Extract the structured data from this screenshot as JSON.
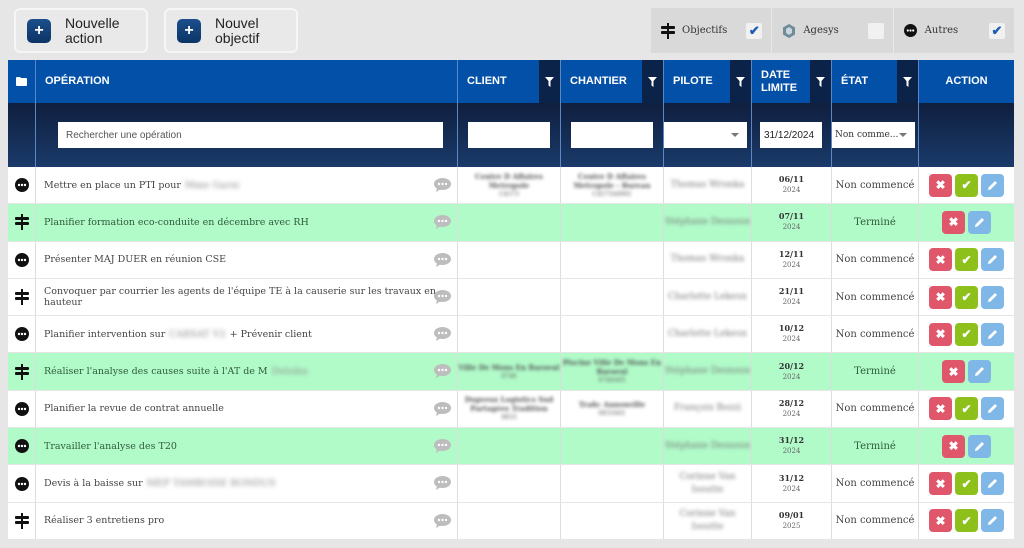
{
  "toolbar": {
    "new_action": "Nouvelle\naction",
    "new_objective": "Nouvel\nobjectif"
  },
  "type_filters": [
    {
      "label": "Objectifs",
      "icon": "signpost-icon",
      "checked": true
    },
    {
      "label": "Agesys",
      "icon": "agesys-logo-icon",
      "checked": false
    },
    {
      "label": "Autres",
      "icon": "ellipsis-circle-icon",
      "checked": true
    }
  ],
  "table": {
    "headers": {
      "operation": "OPÉRATION",
      "client": "CLIENT",
      "chantier": "CHANTIER",
      "pilote": "PILOTE",
      "date_limite": "DATE LIMITE",
      "etat": "ÉTAT",
      "action": "ACTION"
    },
    "filters": {
      "search_placeholder": "Rechercher une opération",
      "client_value": "",
      "chantier_value": "",
      "pilote_value": "",
      "date_value": "31/12/2024",
      "etat_value": "Non comme..."
    },
    "rows": [
      {
        "type": "autre",
        "operation": "Mettre en place un PTI pour",
        "operation_blur": "Mme Garni",
        "client": "Centre D Affaires Metropole",
        "client_code": "C4573",
        "chantier": "Centre D Affaires Metropole - Bureau",
        "chantier_code": "C4573A0001",
        "pilote": "Thomas Wronka",
        "date": "06/11",
        "year": "2024",
        "etat": "Non commencé",
        "done": false
      },
      {
        "type": "objectif",
        "operation": "Planifier formation eco-conduite en décembre avec RH",
        "operation_blur": "",
        "client": "",
        "client_code": "",
        "chantier": "",
        "chantier_code": "",
        "pilote": "Stéphane Desnoux",
        "date": "07/11",
        "year": "2024",
        "etat": "Terminé",
        "done": true
      },
      {
        "type": "autre",
        "operation": "Présenter MAJ DUER en réunion CSE",
        "operation_blur": "",
        "client": "",
        "client_code": "",
        "chantier": "",
        "chantier_code": "",
        "pilote": "Thomas Wronka",
        "date": "12/11",
        "year": "2024",
        "etat": "Non commencé",
        "done": false
      },
      {
        "type": "objectif",
        "operation": "Convoquer par courrier les agents de l'équipe TE à la causerie sur les travaux en hauteur",
        "operation_blur": "",
        "client": "",
        "client_code": "",
        "chantier": "",
        "chantier_code": "",
        "pilote": "Charlotte Lekeux",
        "date": "21/11",
        "year": "2024",
        "etat": "Non commencé",
        "done": false
      },
      {
        "type": "autre",
        "operation": "Planifier intervention sur",
        "operation_blur": "CARSAT V2",
        "operation_suffix": "+ Prévenir client",
        "client": "",
        "client_code": "",
        "chantier": "",
        "chantier_code": "",
        "pilote": "Charlotte Lekeux",
        "date": "10/12",
        "year": "2024",
        "etat": "Non commencé",
        "done": false
      },
      {
        "type": "objectif",
        "operation": "Réaliser l'analyse des causes suite à l'AT de M",
        "operation_blur": "Delsiba",
        "client": "Ville De Mons En Baroeul",
        "client_code": "0746",
        "chantier": "Piscine Ville De Mons En Baroeul",
        "chantier_code": "0746A05",
        "pilote": "Stéphane Desnoux",
        "date": "20/12",
        "year": "2024",
        "etat": "Terminé",
        "done": true
      },
      {
        "type": "autre",
        "operation": "Planifier la revue de contrat annuelle",
        "operation_blur": "",
        "client": "Dupreux Logistics Sud Partagées Tradition",
        "client_code": "0833",
        "chantier": "Trafic Annonville",
        "chantier_code": "0833A01",
        "pilote": "François Bozzi",
        "date": "28/12",
        "year": "2024",
        "etat": "Non commencé",
        "done": false
      },
      {
        "type": "autre",
        "operation": "Travailler l'analyse des T20",
        "operation_blur": "",
        "client": "",
        "client_code": "",
        "chantier": "",
        "chantier_code": "",
        "pilote": "Stéphane Desnoux",
        "date": "31/12",
        "year": "2024",
        "etat": "Terminé",
        "done": true
      },
      {
        "type": "autre",
        "operation": "Devis à la baisse sur",
        "operation_blur": "MEP TAMBOISE BONDUS",
        "client": "",
        "client_code": "",
        "chantier": "",
        "chantier_code": "",
        "pilote": "Corinne Van Isoutte",
        "date": "31/12",
        "year": "2024",
        "etat": "Non commencé",
        "done": false
      },
      {
        "type": "objectif",
        "operation": "Réaliser 3 entretiens pro",
        "operation_blur": "",
        "client": "",
        "client_code": "",
        "chantier": "",
        "chantier_code": "",
        "pilote": "Corinne Van Isoutte",
        "date": "09/01",
        "year": "2025",
        "etat": "Non commencé",
        "done": false
      }
    ]
  },
  "colors": {
    "header_blue": "#0350a8",
    "filter_dark": "#0b2249",
    "done_row": "#b1fbc9",
    "delete": "#e0576c",
    "validate": "#8dc01b",
    "edit": "#7fb7e6"
  }
}
